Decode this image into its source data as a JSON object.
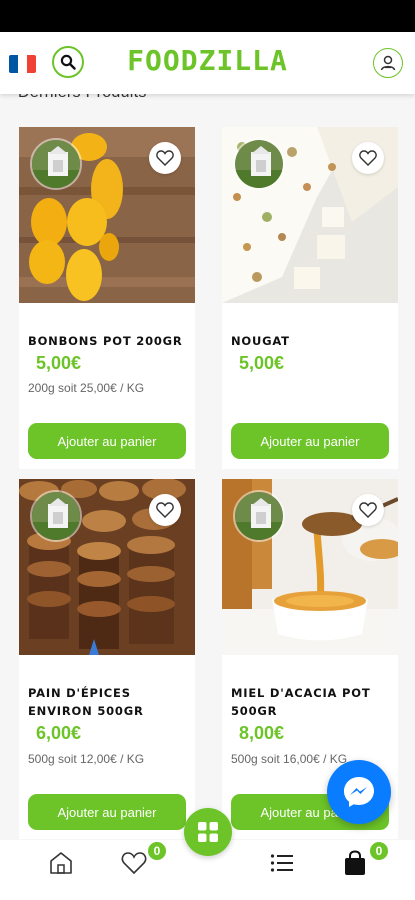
{
  "header": {
    "brand": "FOODZILLA",
    "flag_colors": [
      "#0055a4",
      "#ffffff",
      "#ef4135"
    ],
    "flag_icon": "france-flag-icon",
    "search_icon": "search-icon",
    "account_icon": "user-icon"
  },
  "section": {
    "title": "Derniers Produits"
  },
  "products": [
    {
      "name": "BONBONS POT 200GR",
      "price": "5,00€",
      "unit_price": "200g soit 25,00€ / KG",
      "button": "Ajouter au panier",
      "image_icon": "candies-image"
    },
    {
      "name": "NOUGAT",
      "price": "5,00€",
      "unit_price": "",
      "button": "Ajouter au panier",
      "image_icon": "nougat-image"
    },
    {
      "name": "PAIN D'ÉPICES ENVIRON 500GR",
      "price": "6,00€",
      "unit_price": "500g soit 12,00€ / KG",
      "button": "Ajouter au panier",
      "image_icon": "gingerbread-image"
    },
    {
      "name": "MIEL D'ACACIA POT 500GR",
      "price": "8,00€",
      "unit_price": "500g soit 16,00€ / KG",
      "button": "Ajouter au panier",
      "image_icon": "honey-image"
    }
  ],
  "bottom_nav": {
    "wishlist_count": "0",
    "cart_count": "0"
  },
  "colors": {
    "accent": "#6cc428",
    "messenger": "#0a7cff"
  }
}
